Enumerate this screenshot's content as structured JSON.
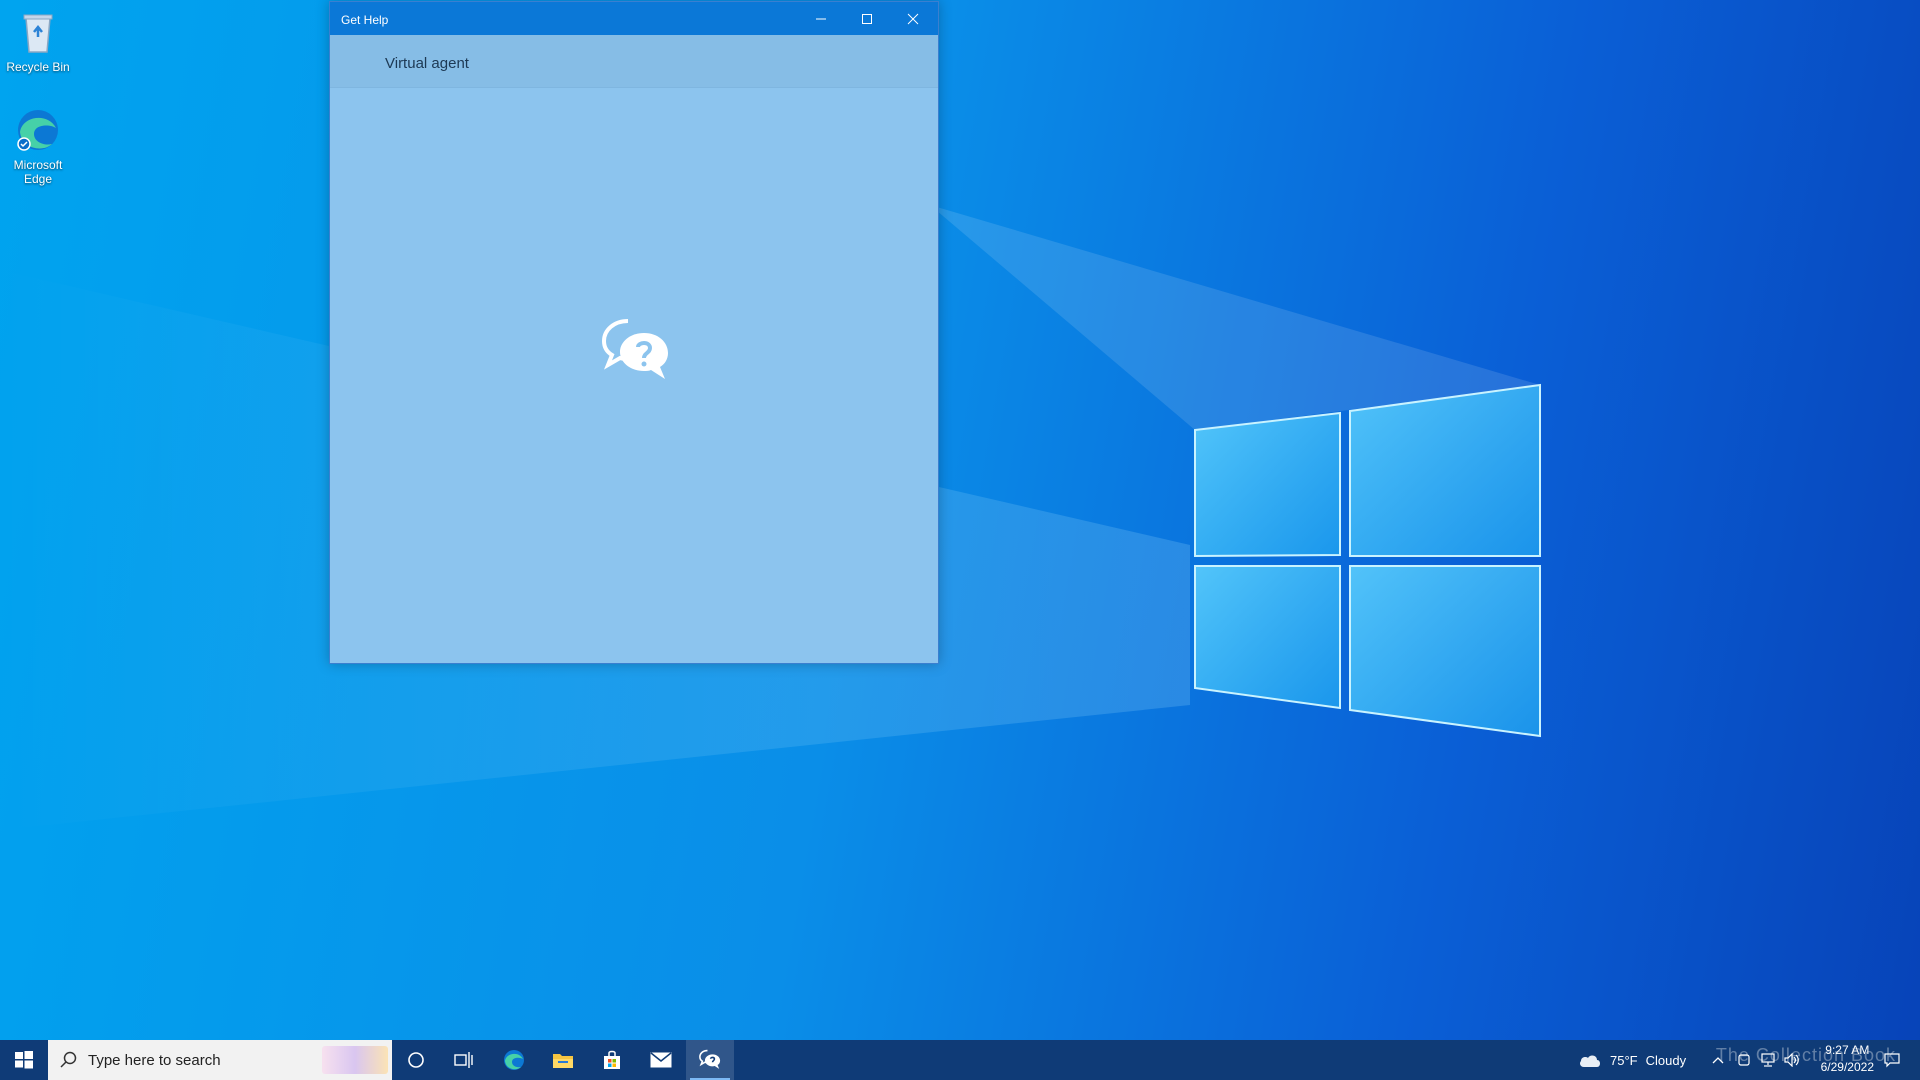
{
  "desktop": {
    "icons": [
      {
        "label": "Recycle Bin",
        "icon": "recycle-bin-icon"
      },
      {
        "label": "Microsoft Edge",
        "icon": "edge-icon"
      }
    ]
  },
  "window": {
    "title": "Get Help",
    "nav_title": "Virtual agent",
    "content_icon": "chat-question-icon",
    "controls": [
      "minimize-icon",
      "maximize-icon",
      "close-icon"
    ]
  },
  "taskbar": {
    "search_placeholder": "Type here to search",
    "pinned": [
      "start-icon",
      "cortana-icon",
      "task-view-icon",
      "edge-icon",
      "file-explorer-icon",
      "store-icon",
      "mail-icon",
      "get-help-icon"
    ],
    "weather": {
      "temp": "75°F",
      "condition": "Cloudy"
    },
    "time": "9:27 AM",
    "date": "6/29/2022"
  },
  "watermark": "The Collection Book",
  "colors": {
    "titlebar": "#0b78d7",
    "window_bg": "#8cc4ee",
    "taskbar": "#0f3b77",
    "accent": "#00a4ef"
  }
}
